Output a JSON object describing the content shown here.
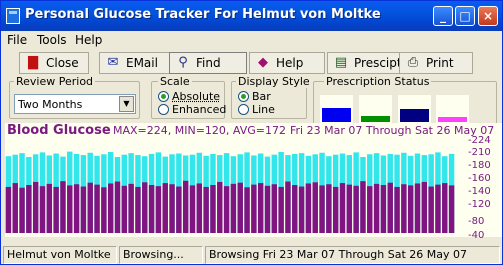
{
  "window": {
    "title": "Personal Glucose Tracker For Helmut von Moltke"
  },
  "menu": [
    "File",
    "Tools",
    "Help"
  ],
  "toolbar": {
    "close": "Close",
    "email": "EMail",
    "find": "Find",
    "help": "Help",
    "prescription": "Presciptn",
    "print": "Print"
  },
  "review_period": {
    "label": "Review Period",
    "value": "Two Months"
  },
  "scale": {
    "label": "Scale",
    "options": [
      "Absolute",
      "Enhanced"
    ],
    "selected": "Absolute"
  },
  "display_style": {
    "label": "Display Style",
    "options": [
      "Bar",
      "Line"
    ],
    "selected": "Bar"
  },
  "prescription_status": {
    "label": "Prescription Status",
    "items": [
      {
        "color": "#0000f0",
        "level": 0.55
      },
      {
        "color": "#009000",
        "level": 0.25
      },
      {
        "color": "#000080",
        "level": 0.5
      },
      {
        "color": "#ff40ff",
        "level": 0.18
      }
    ]
  },
  "chart_header": {
    "title": "Blood Glucose",
    "stats": "MAX=224, MIN=120, AVG=172",
    "range": "Fri 23 Mar 07 Through Sat 26 May 07"
  },
  "chart_data": {
    "type": "bar",
    "ylim": [
      0,
      224
    ],
    "yticks": [
      "224",
      "210",
      "180",
      "160",
      "140",
      "120",
      "80",
      "40"
    ],
    "colors": {
      "max": "#33e6ec",
      "min": "#801480"
    },
    "series": [
      {
        "name": "max",
        "values": [
          200,
          204,
          208,
          198,
          205,
          210,
          202,
          207,
          199,
          212,
          206,
          203,
          209,
          201,
          205,
          211,
          198,
          204,
          208,
          203,
          200,
          206,
          210,
          199,
          205,
          207,
          202,
          204,
          209,
          201,
          206,
          203,
          208,
          200,
          205,
          210,
          202,
          207,
          199,
          204,
          211,
          203,
          206,
          208,
          201,
          205,
          209,
          200,
          204,
          207,
          203,
          210,
          198,
          205,
          208,
          202,
          206,
          204,
          209,
          201,
          207,
          203,
          205,
          210,
          200,
          206
        ]
      },
      {
        "name": "min",
        "values": [
          120,
          130,
          118,
          125,
          133,
          122,
          128,
          120,
          135,
          124,
          127,
          121,
          131,
          126,
          119,
          129,
          134,
          123,
          128,
          120,
          132,
          125,
          122,
          130,
          127,
          121,
          136,
          124,
          129,
          120,
          125,
          133,
          122,
          128,
          131,
          119,
          126,
          130,
          123,
          127,
          120,
          134,
          125,
          121,
          129,
          132,
          124,
          127,
          120,
          130,
          126,
          123,
          135,
          122,
          128,
          125,
          131,
          120,
          127,
          124,
          129,
          133,
          121,
          126,
          130,
          124
        ]
      }
    ]
  },
  "status": {
    "user": "Helmut von Moltke",
    "mode": "Browsing...",
    "detail": "Browsing Fri 23 Mar 07 Through Sat 26 May 07"
  }
}
